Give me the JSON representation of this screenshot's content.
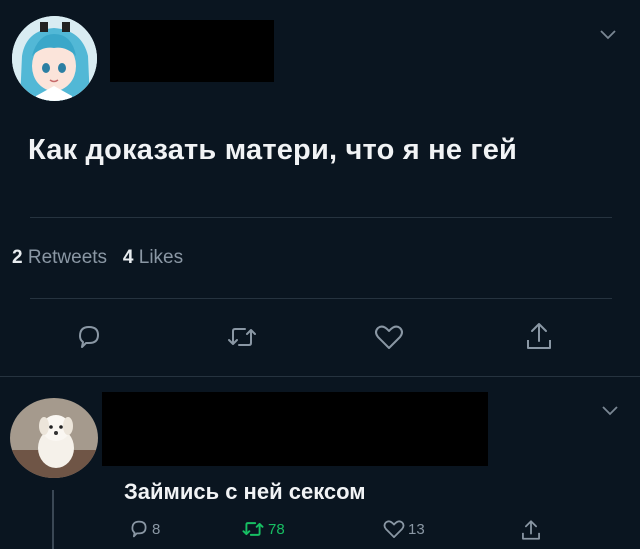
{
  "tweet": {
    "text": "Как доказать матери, что я не гей",
    "retweets_count": "2",
    "retweets_label": "Retweets",
    "likes_count": "4",
    "likes_label": "Likes"
  },
  "reply": {
    "text": "Займись с ней сексом",
    "reply_count": "8",
    "retweet_count": "78",
    "like_count": "13"
  },
  "colors": {
    "background": "#0a1520",
    "muted": "#8a97a4",
    "retweet_green": "#17bf63",
    "divider": "#26333f"
  },
  "icons": [
    "chevron-down-icon",
    "reply-icon",
    "retweet-icon",
    "like-icon",
    "share-icon"
  ]
}
